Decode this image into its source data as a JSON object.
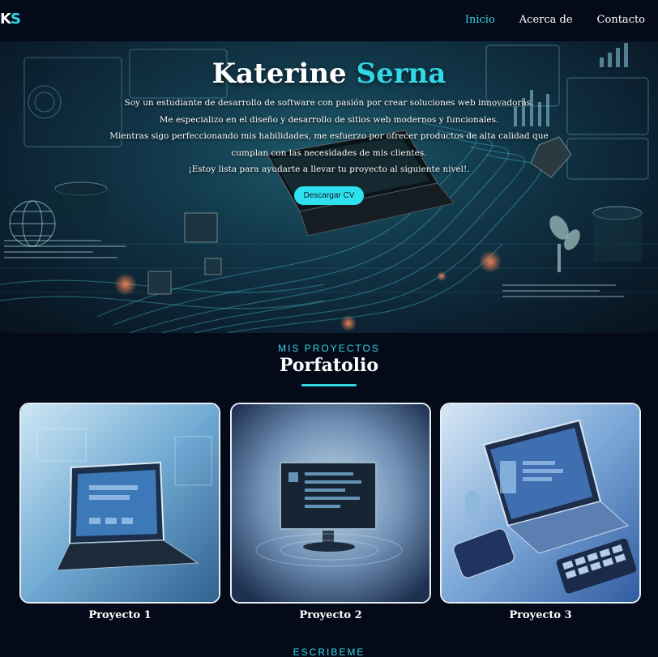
{
  "nav": {
    "logo": {
      "first": "K",
      "second": "S"
    },
    "links": [
      {
        "label": "Inicio",
        "active": true
      },
      {
        "label": "Acerca de",
        "active": false
      },
      {
        "label": "Contacto",
        "active": false
      }
    ]
  },
  "hero": {
    "name_first": "Katerine",
    "name_last": "Serna",
    "description": [
      "Soy un estudiante de desarrollo de software con pasión por crear soluciones web innovadoras.",
      "Me especializo en el diseño y desarrollo de sitios web modernos y funcionales.",
      "Mientras sigo perfeccionando mis habilidades, me esfuerzo por ofrecer productos de alta calidad que",
      "cumplan con las necesidades de mis clientes.",
      "¡Estoy lista para ayudarte a llevar tu proyecto al siguiente nivel!."
    ],
    "cta_label": "Descargar CV"
  },
  "portfolio": {
    "subtitle": "MIS PROYECTOS",
    "title": "Porfatolio",
    "projects": [
      {
        "label": "Proyecto 1"
      },
      {
        "label": "Proyecto 2"
      },
      {
        "label": "Proyecto 3"
      }
    ]
  },
  "contact": {
    "subtitle": "ESCRIBEME"
  },
  "colors": {
    "accent": "#33d7e6",
    "background": "#050a18"
  }
}
